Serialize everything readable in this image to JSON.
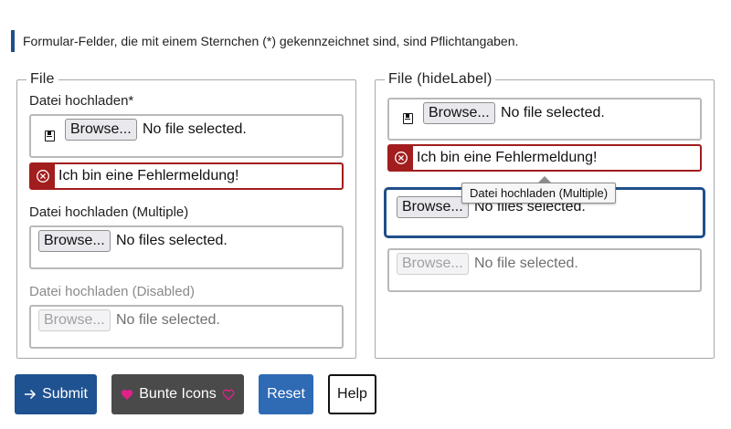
{
  "notice": "Formular-Felder, die mit einem Sternchen (*) gekennzeichnet sind, sind Pflichtangaben.",
  "left": {
    "legend": "File",
    "upload_label": "Datei hochladen*",
    "upload": {
      "browse": "Browse...",
      "status": "No file selected."
    },
    "error": "Ich bin eine Fehlermeldung!",
    "multiple_label": "Datei hochladen (Multiple)",
    "multiple": {
      "browse": "Browse...",
      "status": "No files selected."
    },
    "disabled_label": "Datei hochladen (Disabled)",
    "disabled": {
      "browse": "Browse...",
      "status": "No file selected."
    }
  },
  "right": {
    "legend": "File (hideLabel)",
    "upload": {
      "browse": "Browse...",
      "status": "No file selected."
    },
    "error": "Ich bin eine Fehlermeldung!",
    "tooltip": "Datei hochladen (Multiple)",
    "multiple": {
      "browse": "Browse...",
      "status": "No files selected."
    },
    "disabled": {
      "browse": "Browse...",
      "status": "No file selected."
    }
  },
  "buttons": {
    "submit": "Submit",
    "bunte": "Bunte Icons",
    "reset": "Reset",
    "help": "Help"
  },
  "colors": {
    "primary": "#1f5290",
    "error": "#a21d1d",
    "heart": "#e0218a",
    "dark_button": "#4a4a4a",
    "reset_button": "#2f6ab5"
  },
  "icons": {
    "file": "floppy-disk-icon",
    "error": "circle-x-icon",
    "submit": "arrow-right-icon",
    "bunte_left": "heart-icon",
    "bunte_right": "heart-outline-icon"
  }
}
